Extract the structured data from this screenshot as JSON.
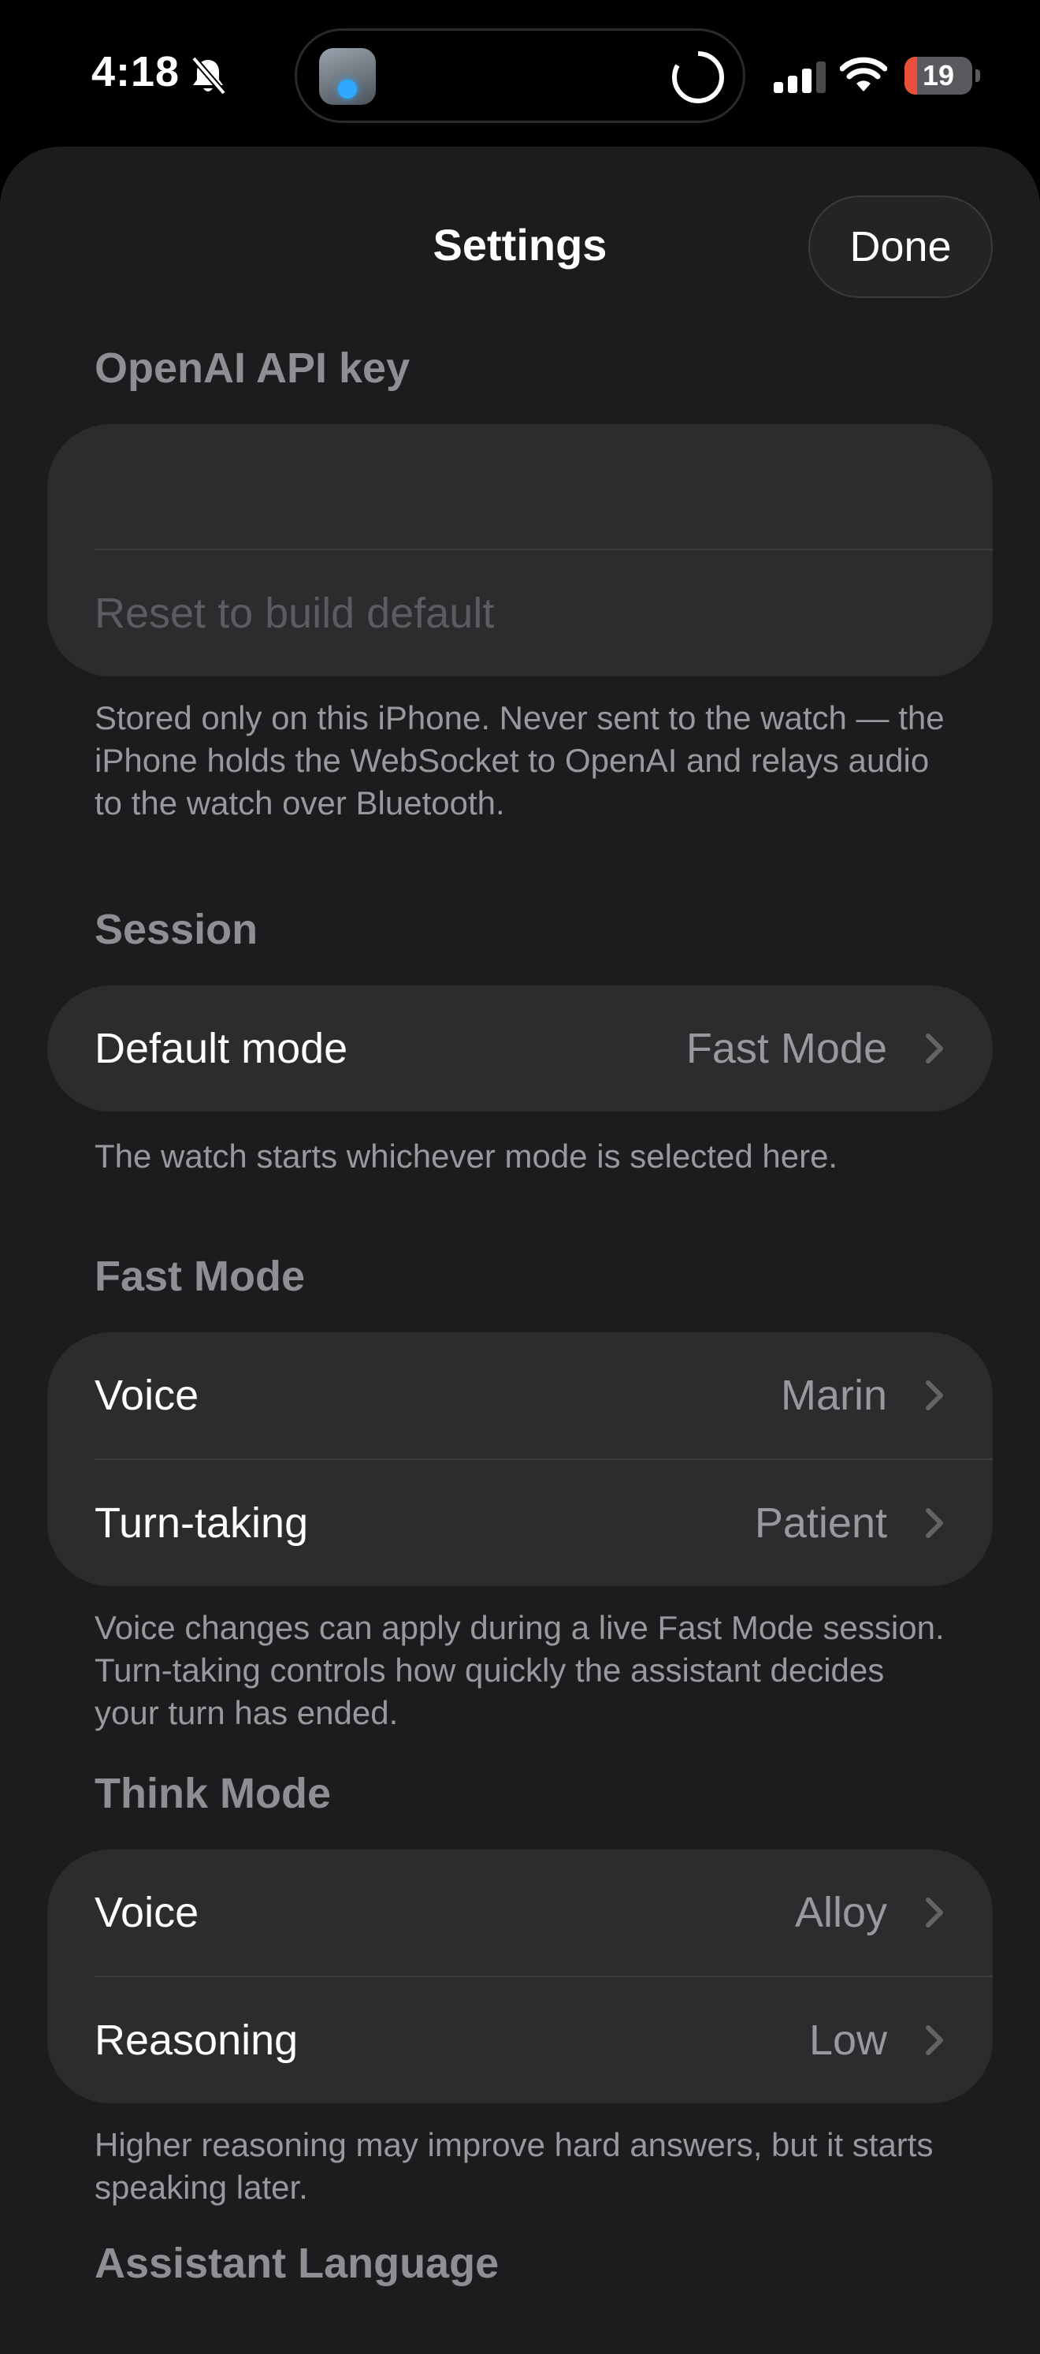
{
  "status_bar": {
    "time": "4:18",
    "battery_level": "19",
    "battery_fraction": 0.19
  },
  "icons": {
    "silent": "bell-slash-icon",
    "signal": "cellular-signal-icon",
    "wifi": "wifi-icon",
    "chevron": "chevron-right-icon"
  },
  "colors": {
    "background": "#1c1c1e",
    "group": "#2c2c2e",
    "secondary_text": "#98989d",
    "battery_low": "#eb4e3d"
  },
  "nav": {
    "title": "Settings",
    "done_label": "Done"
  },
  "api_key": {
    "header": "OpenAI API key",
    "value": "",
    "placeholder": "",
    "reset_label": "Reset to build default",
    "footer": "Stored only on this iPhone. Never sent to the watch — the iPhone holds the WebSocket to OpenAI and relays audio to the watch over Bluetooth."
  },
  "session": {
    "header": "Session",
    "rows": [
      {
        "label": "Default mode",
        "value": "Fast Mode"
      }
    ],
    "footer": "The watch starts whichever mode is selected here."
  },
  "fast_mode": {
    "header": "Fast Mode",
    "rows": [
      {
        "label": "Voice",
        "value": "Marin"
      },
      {
        "label": "Turn-taking",
        "value": "Patient"
      }
    ],
    "footer": "Voice changes can apply during a live Fast Mode session. Turn-taking controls how quickly the assistant decides your turn has ended."
  },
  "think_mode": {
    "header": "Think Mode",
    "rows": [
      {
        "label": "Voice",
        "value": "Alloy"
      },
      {
        "label": "Reasoning",
        "value": "Low"
      }
    ],
    "footer": "Higher reasoning may improve hard answers, but it starts speaking later."
  },
  "next_section": {
    "header": "Assistant Language"
  }
}
